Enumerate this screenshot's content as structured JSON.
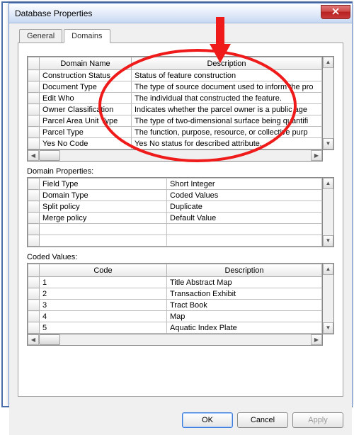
{
  "window": {
    "title": "Database Properties"
  },
  "tabs": [
    {
      "label": "General",
      "active": false
    },
    {
      "label": "Domains",
      "active": true
    }
  ],
  "domains_table": {
    "headers": [
      "Domain Name",
      "Description"
    ],
    "rows": [
      {
        "name": "Construction Status",
        "desc": "Status of feature construction"
      },
      {
        "name": "Document Type",
        "desc": "The type of source document used to inform the pro"
      },
      {
        "name": "Edit Who",
        "desc": "The individual that constructed the feature."
      },
      {
        "name": "Owner Classification",
        "desc": "Indicates whether the parcel owner is a public age"
      },
      {
        "name": "Parcel Area Unit Type",
        "desc": "The type of two-dimensional surface being quantifi"
      },
      {
        "name": "Parcel Type",
        "desc": "The function, purpose, resource, or collective purp"
      },
      {
        "name": "Yes No Code",
        "desc": "Yes No status for described attribute."
      }
    ]
  },
  "domain_properties": {
    "label": "Domain Properties:",
    "rows": [
      {
        "name": "Field Type",
        "value": "Short Integer"
      },
      {
        "name": "Domain Type",
        "value": "Coded Values"
      },
      {
        "name": "Split policy",
        "value": "Duplicate"
      },
      {
        "name": "Merge policy",
        "value": "Default Value"
      }
    ]
  },
  "coded_values": {
    "label": "Coded Values:",
    "headers": [
      "Code",
      "Description"
    ],
    "rows": [
      {
        "code": "1",
        "desc": "Title Abstract Map"
      },
      {
        "code": "2",
        "desc": "Transaction Exhibit"
      },
      {
        "code": "3",
        "desc": "Tract Book"
      },
      {
        "code": "4",
        "desc": "Map"
      },
      {
        "code": "5",
        "desc": "Aquatic Index Plate"
      }
    ]
  },
  "buttons": {
    "ok": "OK",
    "cancel": "Cancel",
    "apply": "Apply"
  },
  "annotation": {
    "stroke": "#ef1a1a"
  }
}
